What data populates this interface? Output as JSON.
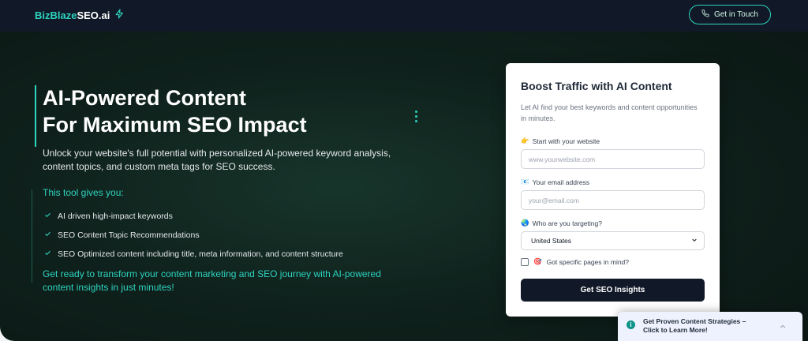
{
  "brand": {
    "name_accent": "BizBlaze",
    "name_rest": "SEO.ai",
    "icon": "lightning-icon"
  },
  "header": {
    "cta_label": "Get in Touch",
    "cta_icon": "phone-icon"
  },
  "hero": {
    "headline_line1": "AI-Powered Content",
    "headline_line2": "For Maximum SEO Impact",
    "subtext": "Unlock your website's full potential with personalized AI-powered keyword analysis, content topics, and custom meta tags for SEO success.",
    "gives_title": "This tool gives you:",
    "features": [
      "AI driven high-impact keywords",
      "SEO Content Topic Recommendations",
      "SEO Optimized content including title, meta information, and content structure"
    ],
    "closing": "Get ready to transform your content marketing and SEO journey with AI-powered content insights in just minutes!"
  },
  "form": {
    "title": "Boost Traffic with AI Content",
    "description": "Let AI find your best keywords and content opportunities in minutes.",
    "website_label_emoji": "👉",
    "website_label": "Start with your website",
    "website_placeholder": "www.yourwebsite.com",
    "email_label_emoji": "📧",
    "email_label": "Your email address",
    "email_placeholder": "your@email.com",
    "target_label_emoji": "🌏",
    "target_label": "Who are you targeting?",
    "target_value": "United States",
    "pages_emoji": "🎯",
    "pages_label": "Got specific pages in mind?",
    "submit_label": "Get SEO Insights"
  },
  "toast": {
    "icon_glyph": "i",
    "text": "Get Proven Content Strategies – Click to Learn More!"
  },
  "colors": {
    "accent": "#2dd4bf",
    "dark": "#111827",
    "background": "#0f211c"
  }
}
